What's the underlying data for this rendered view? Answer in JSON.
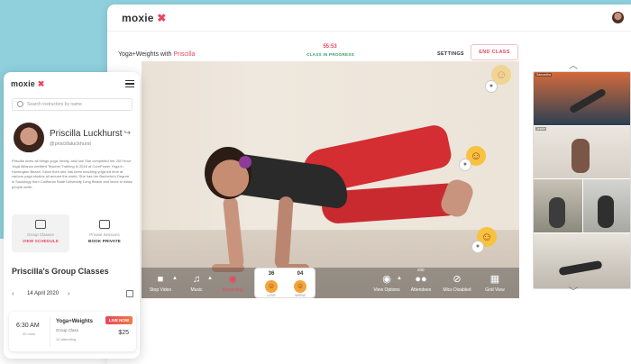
{
  "brand": {
    "name": "moxie",
    "mark": "✖"
  },
  "desktop": {
    "class_title": "Yoga+Weights",
    "class_with": "with",
    "class_instructor": "Priscilla",
    "timer": "55:53",
    "status": "CLASS IN PROGRESS",
    "settings_label": "SETTINGS",
    "end_class_label": "END CLASS",
    "controls": {
      "stop_video": "Stop Video",
      "music": "Music",
      "record": "Recording",
      "view_options": "View Options",
      "attendees": "Attendees",
      "attendees_count": "200",
      "mics_disabled": "Mics Disabled",
      "grid_view": "Grid View"
    },
    "counters": [
      {
        "count": "36",
        "label": "LOVE"
      },
      {
        "count": "04",
        "label": "WHEW"
      }
    ],
    "thumbnails": [
      "Samantha",
      "Jessie",
      "",
      "",
      ""
    ]
  },
  "mobile": {
    "search_placeholder": "Search instructors by name",
    "instructor_name": "Priscilla Luckhurst",
    "instructor_handle": "@priscillaluckhurst",
    "bio": "Priscilla loves all things yoga, family, and hair She completed her 200 Hour Yoga Alliance certified Teacher Training in 2016 at CorePower Yoga in Huntington Beach. Since then she has been teaching yoga full time at various yoga studios all around the world. She has her Bachelor's Degree in Sociology from California State University Long Beach and loves to make people smile.",
    "tiles": [
      {
        "title": "Group Classes",
        "link": "VIEW SCHEDULE"
      },
      {
        "title": "Private Sessions",
        "link": "BOOK PRIVATE"
      }
    ],
    "section_title": "Priscilla's Group Classes",
    "date": "14 April 2020",
    "class_card": {
      "time": "6:30 AM",
      "duration": "30 mins",
      "title": "Yoga+Weights",
      "type": "Group Class",
      "attending": "10 attending",
      "badge": "LIVE NOW",
      "price": "$25"
    }
  },
  "colors": {
    "accent": "#e8475f",
    "teal": "#8fd0dc",
    "status_green": "#2e9a67"
  },
  "icons": [
    "video-camera-icon",
    "music-note-icon",
    "record-icon",
    "eye-icon",
    "attendees-icon",
    "mic-off-icon",
    "grid-icon",
    "share-arrow-icon",
    "search-icon",
    "calendar-icon",
    "menu-icon"
  ]
}
